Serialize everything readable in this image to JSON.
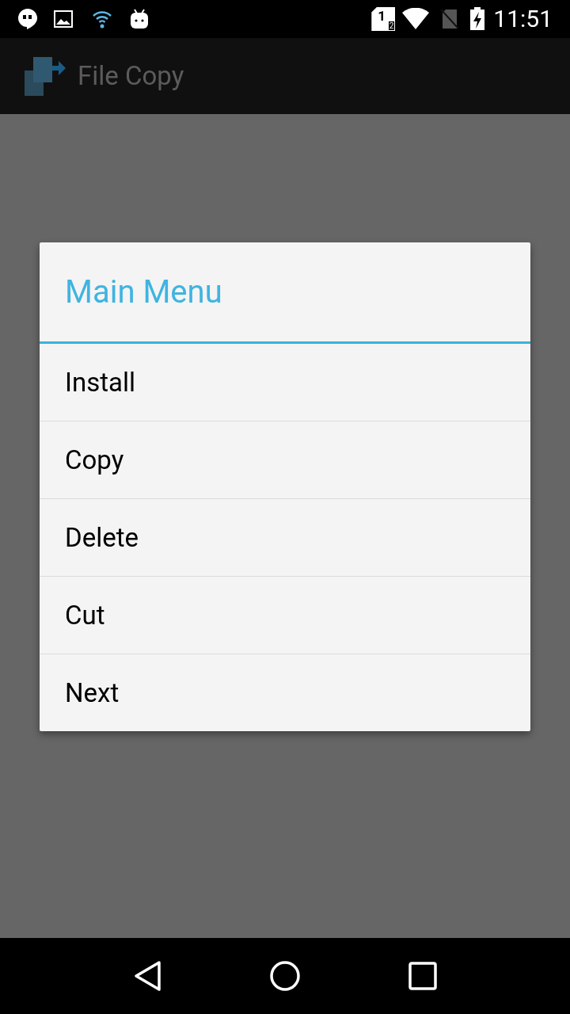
{
  "status_bar": {
    "sim_indicator": {
      "primary": "1",
      "secondary": "2"
    },
    "time": "11:51"
  },
  "app_bar": {
    "title": "File Copy"
  },
  "dialog": {
    "title": "Main Menu",
    "items": [
      {
        "label": "Install"
      },
      {
        "label": "Copy"
      },
      {
        "label": "Delete"
      },
      {
        "label": "Cut"
      },
      {
        "label": "Next"
      }
    ]
  }
}
